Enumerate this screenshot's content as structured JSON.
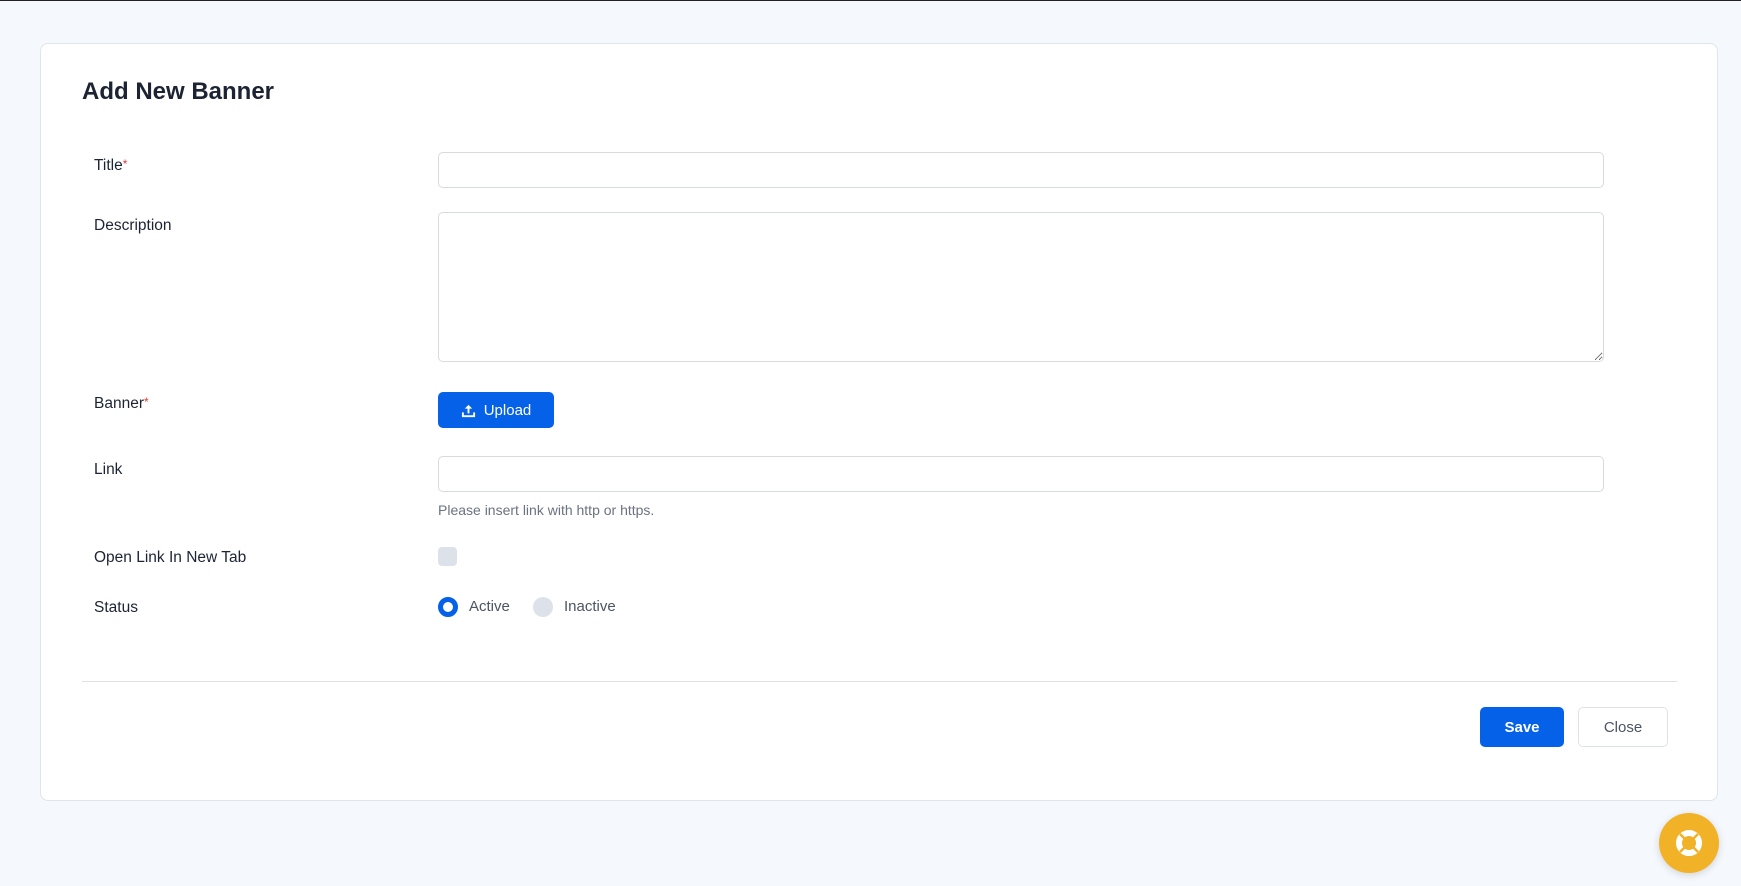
{
  "form": {
    "title": "Add New Banner",
    "required_mark": "*",
    "fields": {
      "title": {
        "label": "Title",
        "value": ""
      },
      "description": {
        "label": "Description",
        "value": ""
      },
      "banner": {
        "label": "Banner",
        "upload_label": "Upload"
      },
      "link": {
        "label": "Link",
        "value": "",
        "help": "Please insert link with http or https."
      },
      "open_new_tab": {
        "label": "Open Link In New Tab",
        "checked": false
      },
      "status": {
        "label": "Status",
        "options": [
          "Active",
          "Inactive"
        ],
        "selected": "Active"
      }
    },
    "save_label": "Save",
    "close_label": "Close"
  },
  "colors": {
    "primary": "#0562e8",
    "help_button": "#f2b228"
  }
}
